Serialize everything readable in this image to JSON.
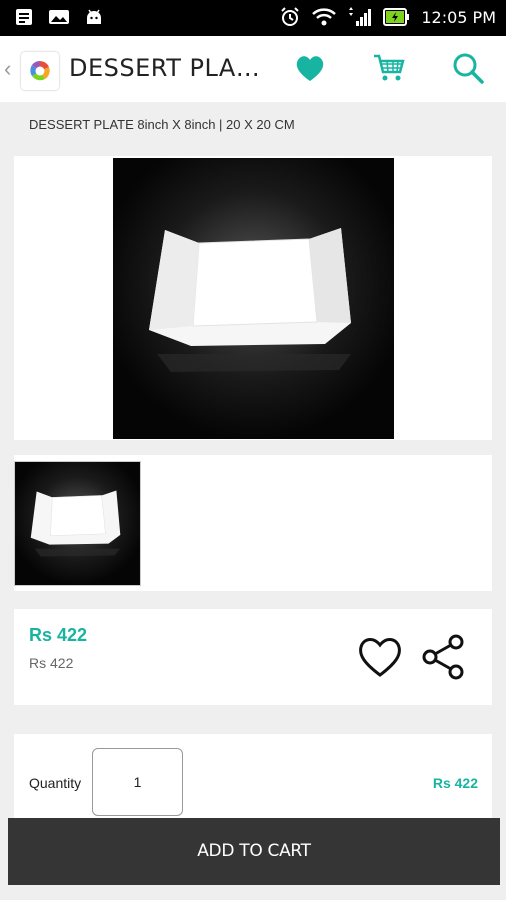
{
  "status_bar": {
    "time": "12:05 PM"
  },
  "app_bar": {
    "title": "DESSERT PLA…"
  },
  "product": {
    "breadcrumb": "DESSERT PLATE 8inch X 8inch | 20 X 20 CM",
    "price": "Rs 422",
    "price_secondary": "Rs 422"
  },
  "quantity": {
    "label": "Quantity",
    "value": "1",
    "total": "Rs 422"
  },
  "actions": {
    "add_to_cart": "ADD TO CART"
  },
  "colors": {
    "accent": "#18b4a2",
    "cta_bg": "#353535"
  },
  "icons": [
    "notification-icon",
    "image-icon",
    "android-icon",
    "alarm-icon",
    "wifi-icon",
    "signal-icon",
    "battery-icon",
    "back-icon",
    "app-logo-icon",
    "heart-icon",
    "cart-icon",
    "search-icon",
    "wishlist-icon",
    "share-icon"
  ]
}
